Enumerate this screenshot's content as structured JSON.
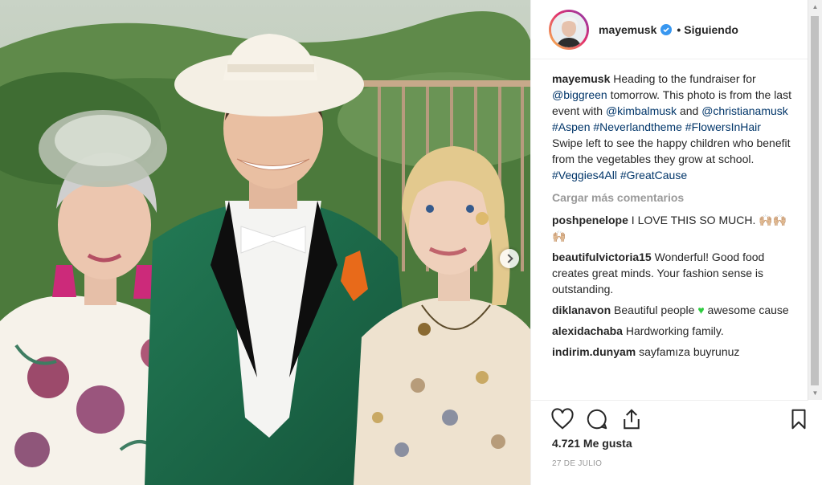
{
  "post": {
    "username": "mayemusk",
    "follow_separator": "•",
    "follow_label": "Siguiendo",
    "caption": {
      "user": "mayemusk",
      "t1": " Heading to the fundraiser for ",
      "tag1": "@biggreen",
      "t2": " tomorrow. This photo is from the last event with ",
      "tag2": "@kimbalmusk",
      "t3": " and ",
      "tag3": "@christianamusk",
      "t4": " ",
      "tag4": "#Aspen",
      "t5": " ",
      "tag5": "#Neverlandtheme",
      "t6": " ",
      "tag6": "#FlowersInHair",
      "t7": " Swipe left to see the happy children who benefit from the vegetables they grow at school. ",
      "tag7": "#Veggies4All",
      "t8": " ",
      "tag8": "#GreatCause"
    },
    "load_more": "Cargar más comentarios",
    "comments": [
      {
        "user": "poshpenelope",
        "text": " I LOVE THIS SO MUCH. 🙌🏼🙌🏼🙌🏼"
      },
      {
        "user": "beautifulvictoria15",
        "text": " Wonderful! Good food creates great minds. Your fashion sense is outstanding."
      },
      {
        "user": "diklanavon",
        "text": " Beautiful people ",
        "emoji": "♥",
        "text2": " awesome cause"
      },
      {
        "user": "alexidachaba",
        "text": " Hardworking family."
      },
      {
        "user": "indirim.dunyam",
        "text": " sayfamıza buyrunuz"
      }
    ],
    "likes": "4.721 Me gusta",
    "date": "27 DE JULIO"
  },
  "icons": {
    "like": "heart-outline-icon",
    "comment": "comment-bubble-icon",
    "share": "share-icon",
    "save": "bookmark-icon",
    "verified": "verified-badge-icon",
    "next": "chevron-right-icon"
  },
  "colors": {
    "hashtag": "#003569",
    "verified": "#3897f0",
    "muted": "#999999",
    "jacket": "#1f6b4a"
  }
}
